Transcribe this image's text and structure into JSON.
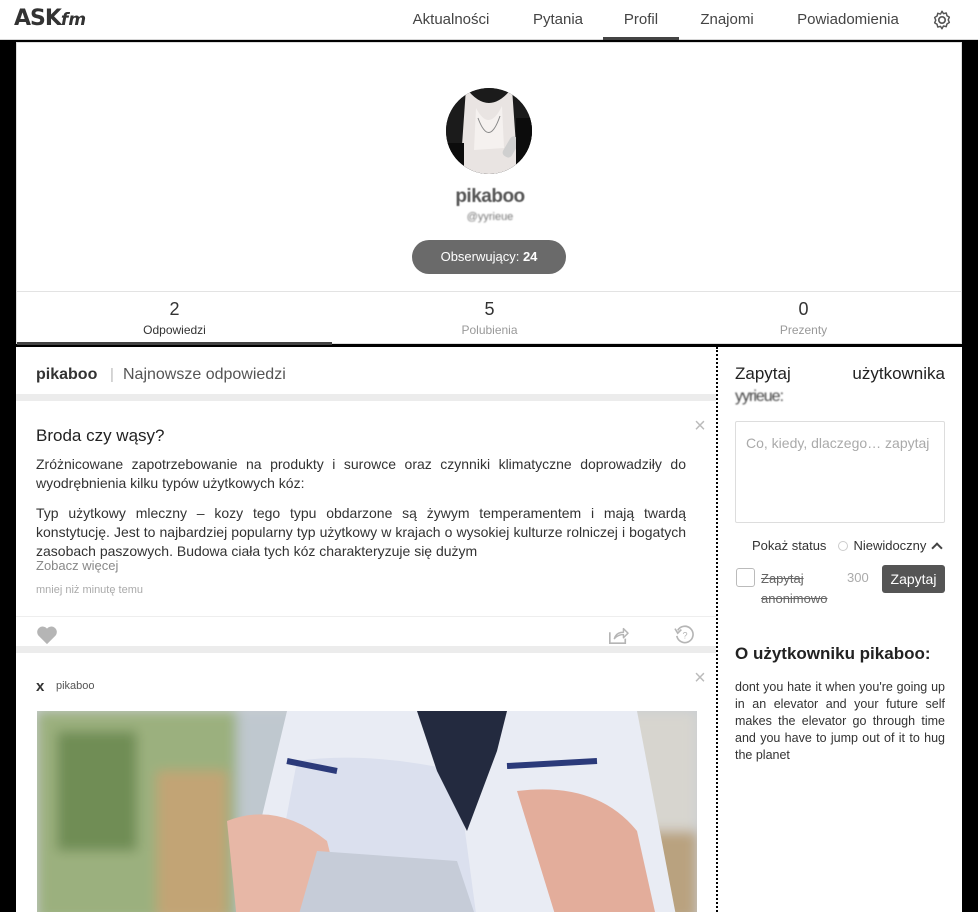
{
  "app": {
    "logo_main": "ASK",
    "logo_suffix": "fm"
  },
  "nav": {
    "items": [
      {
        "label": "Aktualności",
        "active": false
      },
      {
        "label": "Pytania",
        "active": false
      },
      {
        "label": "Profil",
        "active": true
      },
      {
        "label": "Znajomi",
        "active": false
      },
      {
        "label": "Powiadomienia",
        "active": false
      }
    ],
    "settings_icon": "gear-icon"
  },
  "profile": {
    "username": "pikaboo",
    "handle": "@yyrieue",
    "followers_label": "Obserwujący:",
    "followers_count": "24",
    "stats": [
      {
        "num": "2",
        "label": "Odpowiedzi",
        "active": true
      },
      {
        "num": "5",
        "label": "Polubienia",
        "active": false
      },
      {
        "num": "0",
        "label": "Prezenty",
        "active": false
      }
    ]
  },
  "feed": {
    "header_name": "pikaboo",
    "header_sep": "|",
    "header_sub": "Najnowsze odpowiedzi",
    "post1": {
      "question": "Broda czy wąsy?",
      "body_p1": "Zróżnicowane zapotrzebowanie na produkty i surowce oraz czynniki klimatyczne doprowadziły do wyodrębnienia kilku typów użytkowych kóz:",
      "body_p2": "Typ użytkowy mleczny – kozy tego typu obdarzone są żywym temperamentem i mają twardą konstytucję. Jest to najbardziej popularny typ użytkowy w krajach o wysokiej kulturze rolniczej i bogatych zasobach paszowych. Budowa ciała tych kóz charakteryzuje się dużym",
      "see_more": "Zobacz więcej",
      "time": "mniej niż minutę temu",
      "icons": [
        "heart-icon",
        "share-icon",
        "ask-back-icon"
      ]
    },
    "post2": {
      "mark": "x",
      "user": "pikaboo"
    }
  },
  "sidebar": {
    "ask_word1": "Zapytaj",
    "ask_word2": "użytkownika",
    "ask_user_blurred": "yyrieue:",
    "ask_placeholder": "Co, kiedy, dlaczego… zapytaj",
    "status_label": "Pokaż status",
    "status_value": "Niewidoczny",
    "anon_label": "Zapytaj anonimowo",
    "char_count": "300",
    "ask_button": "Zapytaj",
    "about_title": "O użytkowniku pikaboo:",
    "about_text": "dont you hate it when you're going up in an elevator and your future self makes the elevator go through time and you have to jump out of it to hug the planet"
  }
}
